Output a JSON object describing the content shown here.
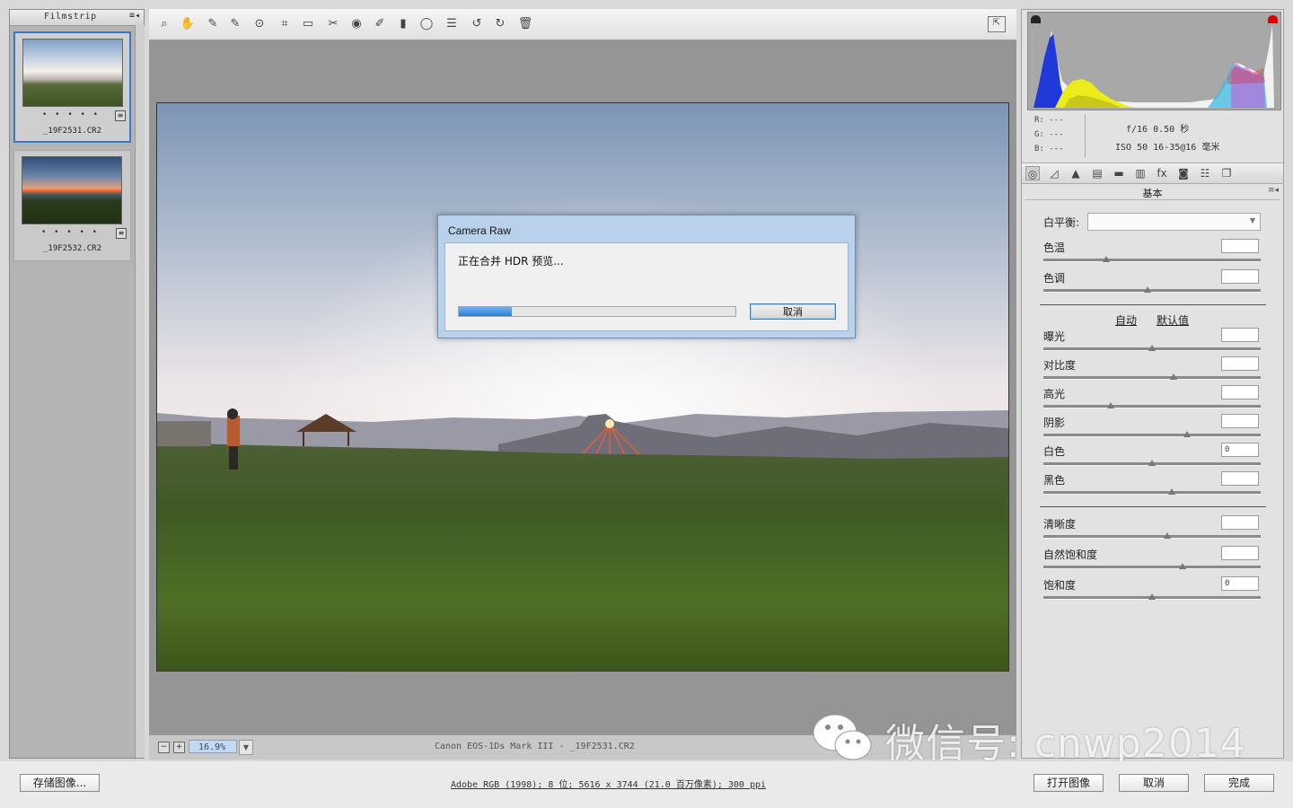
{
  "filmstrip": {
    "title": "Filmstrip",
    "menu_glyph": "≡◂",
    "items": [
      {
        "filename": "_19F2531.CR2",
        "rating": "• • • • •",
        "selected": true
      },
      {
        "filename": "_19F2532.CR2",
        "rating": "• • • • •",
        "selected": false
      }
    ]
  },
  "toolbar": {
    "tools": [
      "zoom-tool",
      "hand-tool",
      "white-balance-tool",
      "color-sampler-tool",
      "targeted-adjustment-tool",
      "crop-tool",
      "straighten-tool",
      "spot-removal-tool",
      "red-eye-tool",
      "adjustment-brush-tool",
      "graduated-filter-tool",
      "radial-filter-tool",
      "preferences",
      "rotate-left",
      "rotate-right",
      "trash"
    ],
    "glyphs": [
      "⌕",
      "✋",
      "✎",
      "✎",
      "⊙",
      "⌗",
      "▭",
      "✂",
      "◉",
      "✐",
      "▮",
      "◯",
      "☰",
      "↺",
      "↻",
      "🗑"
    ]
  },
  "statusbar": {
    "zoom": "16.9%",
    "camera_info": "Canon EOS-1Ds Mark III -  _19F2531.CR2"
  },
  "dialog": {
    "title": "Camera Raw",
    "message": "正在合并 HDR 预览...",
    "progress": 0.19,
    "cancel_label": "取消"
  },
  "info": {
    "r": "R:  ---",
    "g": "G:  ---",
    "b": "B:  ---",
    "aperture_shutter": "f/16   0.50 秒",
    "iso_lens": "ISO 50   16-35@16 毫米"
  },
  "panel": {
    "title": "基本",
    "menu_glyph": "≡◂",
    "white_balance_label": "白平衡:",
    "white_balance_value": "",
    "auto_label": "自动",
    "default_label": "默认值",
    "sliders": [
      {
        "key": "temperature",
        "label": "色温",
        "value": "",
        "pos": 0.29
      },
      {
        "key": "tint",
        "label": "色调",
        "value": "",
        "pos": 0.48
      },
      {
        "key": "exposure",
        "label": "曝光",
        "value": "",
        "pos": 0.5
      },
      {
        "key": "contrast",
        "label": "对比度",
        "value": "",
        "pos": 0.6
      },
      {
        "key": "highlights",
        "label": "高光",
        "value": "",
        "pos": 0.31
      },
      {
        "key": "shadows",
        "label": "阴影",
        "value": "",
        "pos": 0.66
      },
      {
        "key": "whites",
        "label": "白色",
        "value": "0",
        "pos": 0.5
      },
      {
        "key": "blacks",
        "label": "黑色",
        "value": "",
        "pos": 0.59
      },
      {
        "key": "clarity",
        "label": "清晰度",
        "value": "",
        "pos": 0.57
      },
      {
        "key": "vibrance",
        "label": "自然饱和度",
        "value": "",
        "pos": 0.64
      },
      {
        "key": "saturation",
        "label": "饱和度",
        "value": "0",
        "pos": 0.5
      }
    ]
  },
  "tabs": [
    "基本",
    "色调曲线",
    "细节",
    "HSL/灰度",
    "分离色调",
    "镜头校正",
    "效果",
    "相机校准",
    "预设",
    "快照"
  ],
  "tab_glyphs": [
    "◎",
    "◿",
    "▲",
    "▤",
    "▬",
    "▥",
    "fx",
    "◙",
    "☷",
    "❐"
  ],
  "bottom": {
    "save_label": "存储图像...",
    "workflow_info": "Adobe RGB (1998); 8 位;  5616 x 3744 (21.0 百万像素); 300 ppi",
    "open_label": "打开图像",
    "cancel_label": "取消",
    "done_label": "完成"
  },
  "watermark": {
    "text": "微信号: cnwp2014"
  }
}
